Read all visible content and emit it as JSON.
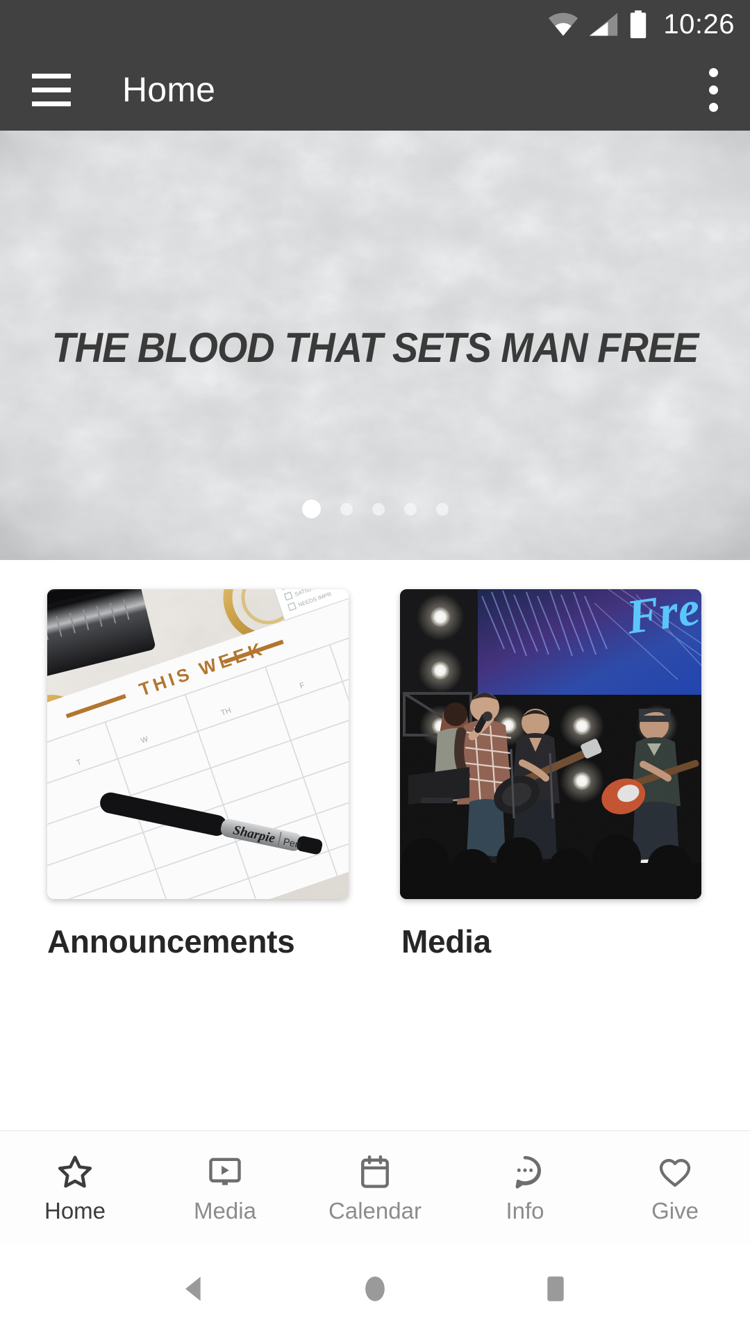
{
  "status_bar": {
    "time": "10:26",
    "icons": [
      "wifi-icon",
      "cell-signal-icon",
      "battery-icon"
    ]
  },
  "app_bar": {
    "menu_icon": "hamburger-menu-icon",
    "title": "Home",
    "overflow_icon": "overflow-menu-icon"
  },
  "hero": {
    "title": "THE BLOOD THAT SETS MAN FREE",
    "background": "concrete-texture",
    "slide_count": 5,
    "active_slide": 1
  },
  "cards": [
    {
      "label": "Announcements",
      "image": "weekly-planner-photo"
    },
    {
      "label": "Media",
      "image": "worship-band-stage-photo"
    }
  ],
  "tabs": [
    {
      "label": "Home",
      "icon": "star-icon",
      "active": true
    },
    {
      "label": "Media",
      "icon": "video-player-icon",
      "active": false
    },
    {
      "label": "Calendar",
      "icon": "calendar-icon",
      "active": false
    },
    {
      "label": "Info",
      "icon": "chat-bubble-icon",
      "active": false
    },
    {
      "label": "Give",
      "icon": "heart-icon",
      "active": false
    }
  ],
  "system_nav": [
    {
      "name": "back-button",
      "icon": "triangle-left-icon"
    },
    {
      "name": "home-button",
      "icon": "circle-icon"
    },
    {
      "name": "recents-button",
      "icon": "square-icon"
    }
  ],
  "colors": {
    "app_bar": "#414141",
    "tab_active": "#3d3d3d",
    "tab_inactive": "#8c8c8c",
    "card_label": "#262626"
  }
}
